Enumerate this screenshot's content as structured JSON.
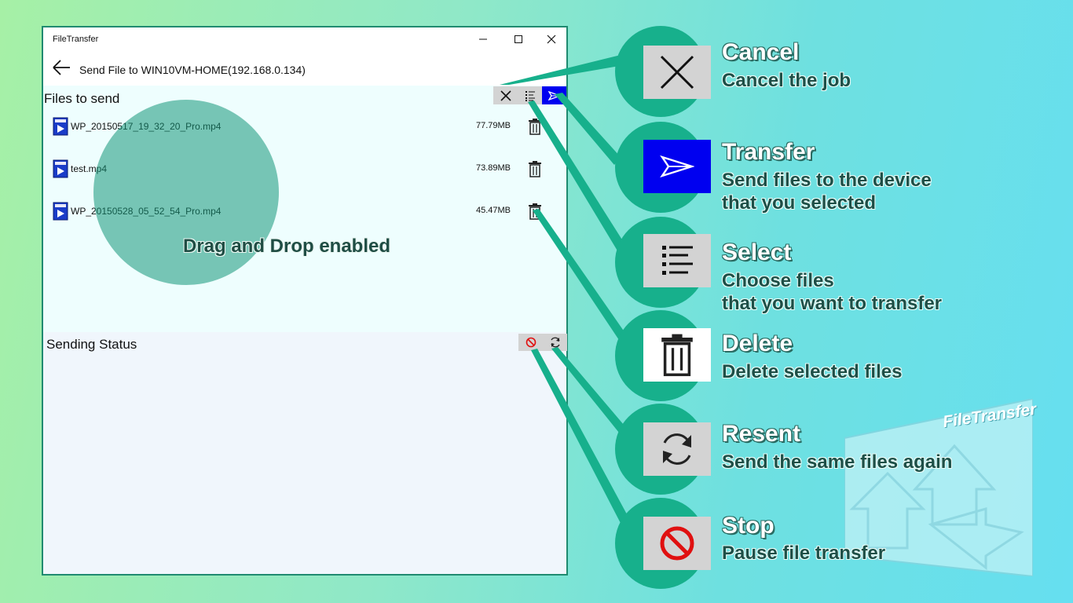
{
  "window": {
    "app_title": "FileTransfer",
    "page_title": "Send File to WIN10VM-HOME(192.168.0.134)"
  },
  "files_panel": {
    "title": "Files to send",
    "files": [
      {
        "name": "WP_20150517_19_32_20_Pro.mp4",
        "size": "77.79MB"
      },
      {
        "name": "test.mp4",
        "size": "73.89MB"
      },
      {
        "name": "WP_20150528_05_52_54_Pro.mp4",
        "size": "45.47MB"
      }
    ],
    "drag_hint": "Drag and Drop enabled"
  },
  "status_panel": {
    "title": "Sending Status"
  },
  "legend": [
    {
      "icon": "cancel-x-icon",
      "title": "Cancel",
      "desc": [
        "Cancel the job"
      ]
    },
    {
      "icon": "send-arrow-icon",
      "title": "Transfer",
      "desc": [
        "Send files to the device",
        "that you selected"
      ]
    },
    {
      "icon": "select-list-icon",
      "title": "Select",
      "desc": [
        "Choose files",
        "that you want to transfer"
      ]
    },
    {
      "icon": "trash-icon",
      "title": "Delete",
      "desc": [
        "Delete selected files"
      ]
    },
    {
      "icon": "refresh-icon",
      "title": "Resent",
      "desc": [
        "Send the same files again"
      ]
    },
    {
      "icon": "stop-icon",
      "title": "Stop",
      "desc": [
        "Pause file transfer"
      ]
    }
  ],
  "logo": {
    "text": "FileTransfer"
  },
  "colors": {
    "accent": "#17b08c",
    "transfer_blue": "#0000f0",
    "stop_red": "#e01010",
    "window_border": "#1f8a70"
  }
}
